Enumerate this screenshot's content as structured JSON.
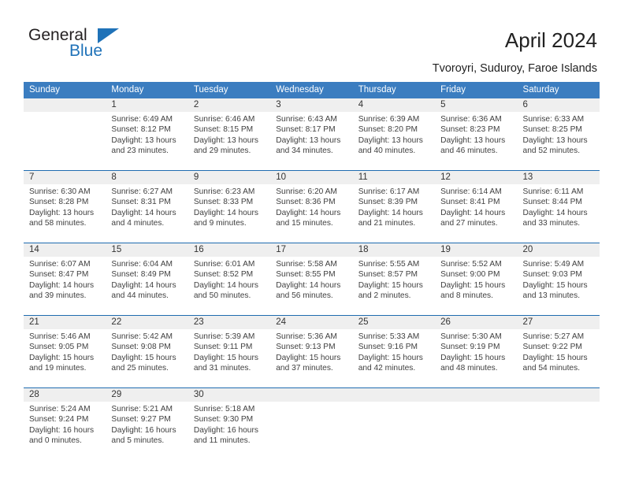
{
  "brand": {
    "name_part1": "General",
    "name_part2": "Blue",
    "triangle_color": "#1f72b8"
  },
  "header": {
    "title": "April 2024",
    "subtitle": "Tvoroyri, Suduroy, Faroe Islands"
  },
  "theme": {
    "header_blue": "#3b7dc0",
    "rule_blue": "#1f6cb0",
    "daynum_band": "#efefef"
  },
  "calendar": {
    "day_names": [
      "Sunday",
      "Monday",
      "Tuesday",
      "Wednesday",
      "Thursday",
      "Friday",
      "Saturday"
    ],
    "weeks": [
      [
        {
          "day": "",
          "lines": []
        },
        {
          "day": "1",
          "lines": [
            "Sunrise: 6:49 AM",
            "Sunset: 8:12 PM",
            "Daylight: 13 hours",
            "and 23 minutes."
          ]
        },
        {
          "day": "2",
          "lines": [
            "Sunrise: 6:46 AM",
            "Sunset: 8:15 PM",
            "Daylight: 13 hours",
            "and 29 minutes."
          ]
        },
        {
          "day": "3",
          "lines": [
            "Sunrise: 6:43 AM",
            "Sunset: 8:17 PM",
            "Daylight: 13 hours",
            "and 34 minutes."
          ]
        },
        {
          "day": "4",
          "lines": [
            "Sunrise: 6:39 AM",
            "Sunset: 8:20 PM",
            "Daylight: 13 hours",
            "and 40 minutes."
          ]
        },
        {
          "day": "5",
          "lines": [
            "Sunrise: 6:36 AM",
            "Sunset: 8:23 PM",
            "Daylight: 13 hours",
            "and 46 minutes."
          ]
        },
        {
          "day": "6",
          "lines": [
            "Sunrise: 6:33 AM",
            "Sunset: 8:25 PM",
            "Daylight: 13 hours",
            "and 52 minutes."
          ]
        }
      ],
      [
        {
          "day": "7",
          "lines": [
            "Sunrise: 6:30 AM",
            "Sunset: 8:28 PM",
            "Daylight: 13 hours",
            "and 58 minutes."
          ]
        },
        {
          "day": "8",
          "lines": [
            "Sunrise: 6:27 AM",
            "Sunset: 8:31 PM",
            "Daylight: 14 hours",
            "and 4 minutes."
          ]
        },
        {
          "day": "9",
          "lines": [
            "Sunrise: 6:23 AM",
            "Sunset: 8:33 PM",
            "Daylight: 14 hours",
            "and 9 minutes."
          ]
        },
        {
          "day": "10",
          "lines": [
            "Sunrise: 6:20 AM",
            "Sunset: 8:36 PM",
            "Daylight: 14 hours",
            "and 15 minutes."
          ]
        },
        {
          "day": "11",
          "lines": [
            "Sunrise: 6:17 AM",
            "Sunset: 8:39 PM",
            "Daylight: 14 hours",
            "and 21 minutes."
          ]
        },
        {
          "day": "12",
          "lines": [
            "Sunrise: 6:14 AM",
            "Sunset: 8:41 PM",
            "Daylight: 14 hours",
            "and 27 minutes."
          ]
        },
        {
          "day": "13",
          "lines": [
            "Sunrise: 6:11 AM",
            "Sunset: 8:44 PM",
            "Daylight: 14 hours",
            "and 33 minutes."
          ]
        }
      ],
      [
        {
          "day": "14",
          "lines": [
            "Sunrise: 6:07 AM",
            "Sunset: 8:47 PM",
            "Daylight: 14 hours",
            "and 39 minutes."
          ]
        },
        {
          "day": "15",
          "lines": [
            "Sunrise: 6:04 AM",
            "Sunset: 8:49 PM",
            "Daylight: 14 hours",
            "and 44 minutes."
          ]
        },
        {
          "day": "16",
          "lines": [
            "Sunrise: 6:01 AM",
            "Sunset: 8:52 PM",
            "Daylight: 14 hours",
            "and 50 minutes."
          ]
        },
        {
          "day": "17",
          "lines": [
            "Sunrise: 5:58 AM",
            "Sunset: 8:55 PM",
            "Daylight: 14 hours",
            "and 56 minutes."
          ]
        },
        {
          "day": "18",
          "lines": [
            "Sunrise: 5:55 AM",
            "Sunset: 8:57 PM",
            "Daylight: 15 hours",
            "and 2 minutes."
          ]
        },
        {
          "day": "19",
          "lines": [
            "Sunrise: 5:52 AM",
            "Sunset: 9:00 PM",
            "Daylight: 15 hours",
            "and 8 minutes."
          ]
        },
        {
          "day": "20",
          "lines": [
            "Sunrise: 5:49 AM",
            "Sunset: 9:03 PM",
            "Daylight: 15 hours",
            "and 13 minutes."
          ]
        }
      ],
      [
        {
          "day": "21",
          "lines": [
            "Sunrise: 5:46 AM",
            "Sunset: 9:05 PM",
            "Daylight: 15 hours",
            "and 19 minutes."
          ]
        },
        {
          "day": "22",
          "lines": [
            "Sunrise: 5:42 AM",
            "Sunset: 9:08 PM",
            "Daylight: 15 hours",
            "and 25 minutes."
          ]
        },
        {
          "day": "23",
          "lines": [
            "Sunrise: 5:39 AM",
            "Sunset: 9:11 PM",
            "Daylight: 15 hours",
            "and 31 minutes."
          ]
        },
        {
          "day": "24",
          "lines": [
            "Sunrise: 5:36 AM",
            "Sunset: 9:13 PM",
            "Daylight: 15 hours",
            "and 37 minutes."
          ]
        },
        {
          "day": "25",
          "lines": [
            "Sunrise: 5:33 AM",
            "Sunset: 9:16 PM",
            "Daylight: 15 hours",
            "and 42 minutes."
          ]
        },
        {
          "day": "26",
          "lines": [
            "Sunrise: 5:30 AM",
            "Sunset: 9:19 PM",
            "Daylight: 15 hours",
            "and 48 minutes."
          ]
        },
        {
          "day": "27",
          "lines": [
            "Sunrise: 5:27 AM",
            "Sunset: 9:22 PM",
            "Daylight: 15 hours",
            "and 54 minutes."
          ]
        }
      ],
      [
        {
          "day": "28",
          "lines": [
            "Sunrise: 5:24 AM",
            "Sunset: 9:24 PM",
            "Daylight: 16 hours",
            "and 0 minutes."
          ]
        },
        {
          "day": "29",
          "lines": [
            "Sunrise: 5:21 AM",
            "Sunset: 9:27 PM",
            "Daylight: 16 hours",
            "and 5 minutes."
          ]
        },
        {
          "day": "30",
          "lines": [
            "Sunrise: 5:18 AM",
            "Sunset: 9:30 PM",
            "Daylight: 16 hours",
            "and 11 minutes."
          ]
        },
        {
          "day": "",
          "lines": []
        },
        {
          "day": "",
          "lines": []
        },
        {
          "day": "",
          "lines": []
        },
        {
          "day": "",
          "lines": []
        }
      ]
    ]
  }
}
